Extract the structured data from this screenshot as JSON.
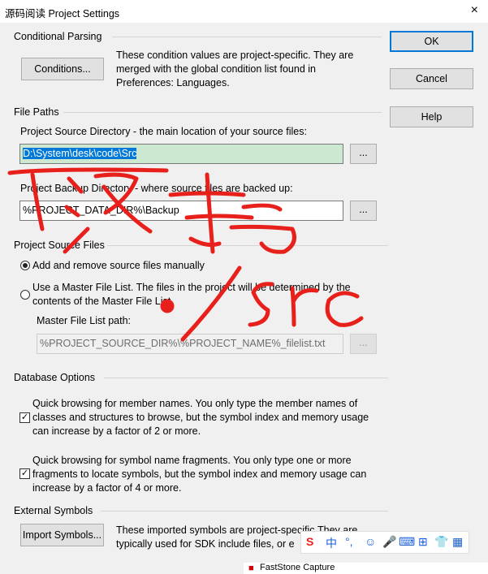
{
  "window": {
    "title": "源码阅读 Project Settings",
    "close_label": "×"
  },
  "buttons": {
    "ok": "OK",
    "cancel": "Cancel",
    "help": "Help",
    "conditions": "Conditions...",
    "browse1": "...",
    "browse2": "...",
    "browse3": "...",
    "import": "Import Symbols..."
  },
  "conditional": {
    "label": "Conditional Parsing",
    "description": [
      "These condition values are project-specific.  They are",
      "merged with the global condition list found in",
      "Preferences: Languages."
    ]
  },
  "file_paths": {
    "label": "File Paths",
    "source_label": "Project Source Directory - the main location of your source files:",
    "source_value": "D:\\System\\desk\\code\\Src",
    "backup_label": "Project Backup Directory - where source files are backed up:",
    "backup_value": "%PROJECT_DATA_DIR%\\Backup"
  },
  "source_files": {
    "label": "Project Source Files",
    "opt1": "Add and remove source files manually",
    "opt2_lines": [
      "Use a Master File List. The files in the project will be determined by the",
      "contents of the Master File List."
    ],
    "master_label": "Master File List path:",
    "master_value": "%PROJECT_SOURCE_DIR%\\%PROJECT_NAME%_filelist.txt"
  },
  "database": {
    "label": "Database Options",
    "opt1_lines": [
      "Quick browsing for member names.  You only type the member names of",
      "classes and structures to browse, but the symbol index and memory usage",
      "can increase by a factor of 2 or more."
    ],
    "opt2_lines": [
      "Quick browsing for symbol name fragments.  You only type one or more",
      "fragments to locate symbols, but the symbol index and memory usage can",
      "increase by a factor of 4 or more."
    ]
  },
  "external": {
    "label": "External Symbols",
    "description": [
      "These imported symbols are project-specific.They are",
      "typically used for SDK include files, or e"
    ]
  },
  "ime": {
    "lang": "中"
  },
  "taskbar": {
    "app": "FastStone Capture"
  },
  "annotation": {
    "handwritten_text": "改为 ./Src",
    "color": "#e8201c"
  }
}
